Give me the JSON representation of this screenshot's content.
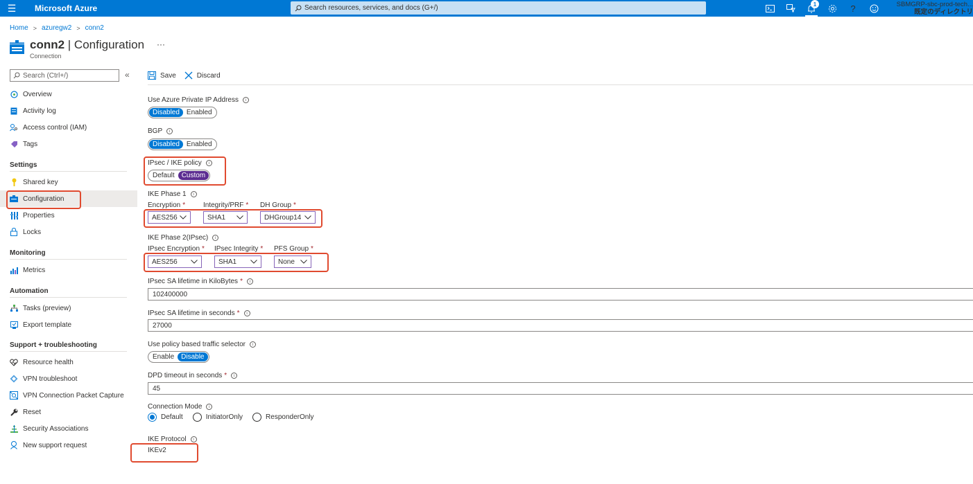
{
  "topbar": {
    "brand": "Microsoft Azure",
    "search_placeholder": "Search resources, services, and docs (G+/)",
    "notification_count": "1",
    "user_line1": "SBMGRP-sbc-prod-tech...",
    "user_line2": "既定のディレクトリ"
  },
  "breadcrumb": [
    "Home",
    "azuregw2",
    "conn2"
  ],
  "page": {
    "title_bold": "conn2",
    "title_rest": " | Configuration",
    "subtitle": "Connection",
    "more": "···"
  },
  "sidebar": {
    "search_placeholder": "Search (Ctrl+/)",
    "collapse": "«",
    "items": [
      {
        "label": "Overview",
        "icon": "overview-icon"
      },
      {
        "label": "Activity log",
        "icon": "activity-log-icon"
      },
      {
        "label": "Access control (IAM)",
        "icon": "iam-icon"
      },
      {
        "label": "Tags",
        "icon": "tag-icon"
      }
    ],
    "sections": [
      {
        "title": "Settings",
        "items": [
          {
            "label": "Shared key",
            "icon": "key-icon"
          },
          {
            "label": "Configuration",
            "icon": "configuration-icon",
            "active": true
          },
          {
            "label": "Properties",
            "icon": "properties-icon"
          },
          {
            "label": "Locks",
            "icon": "lock-icon"
          }
        ]
      },
      {
        "title": "Monitoring",
        "items": [
          {
            "label": "Metrics",
            "icon": "metrics-icon"
          }
        ]
      },
      {
        "title": "Automation",
        "items": [
          {
            "label": "Tasks (preview)",
            "icon": "tasks-icon"
          },
          {
            "label": "Export template",
            "icon": "export-template-icon"
          }
        ]
      },
      {
        "title": "Support + troubleshooting",
        "items": [
          {
            "label": "Resource health",
            "icon": "resource-health-icon"
          },
          {
            "label": "VPN troubleshoot",
            "icon": "vpn-troubleshoot-icon"
          },
          {
            "label": "VPN Connection Packet Capture",
            "icon": "packet-capture-icon"
          },
          {
            "label": "Reset",
            "icon": "reset-icon"
          },
          {
            "label": "Security Associations",
            "icon": "security-associations-icon"
          },
          {
            "label": "New support request",
            "icon": "support-icon"
          }
        ]
      }
    ]
  },
  "toolbar": {
    "save": "Save",
    "discard": "Discard"
  },
  "form": {
    "private_ip": {
      "label": "Use Azure Private IP Address",
      "options": [
        "Disabled",
        "Enabled"
      ],
      "selected": "Disabled"
    },
    "bgp": {
      "label": "BGP",
      "options": [
        "Disabled",
        "Enabled"
      ],
      "selected": "Disabled"
    },
    "ipsec_policy": {
      "label": "IPsec / IKE policy",
      "options": [
        "Default",
        "Custom"
      ],
      "selected": "Custom"
    },
    "ike_phase1": {
      "label": "IKE Phase 1",
      "encryption": {
        "label": "Encryption",
        "value": "AES256"
      },
      "integrity": {
        "label": "Integrity/PRF",
        "value": "SHA1"
      },
      "dh_group": {
        "label": "DH Group",
        "value": "DHGroup14"
      }
    },
    "ike_phase2": {
      "label": "IKE Phase 2(IPsec)",
      "encryption": {
        "label": "IPsec Encryption",
        "value": "AES256"
      },
      "integrity": {
        "label": "IPsec Integrity",
        "value": "SHA1"
      },
      "pfs_group": {
        "label": "PFS Group",
        "value": "None"
      }
    },
    "sa_kb": {
      "label": "IPsec SA lifetime in KiloBytes",
      "value": "102400000"
    },
    "sa_sec": {
      "label": "IPsec SA lifetime in seconds",
      "value": "27000"
    },
    "policy_selector": {
      "label": "Use policy based traffic selector",
      "options": [
        "Enable",
        "Disable"
      ],
      "selected": "Disable"
    },
    "dpd": {
      "label": "DPD timeout in seconds",
      "value": "45"
    },
    "conn_mode": {
      "label": "Connection Mode",
      "options": [
        "Default",
        "InitiatorOnly",
        "ResponderOnly"
      ],
      "selected": "Default"
    },
    "ike_protocol": {
      "label": "IKE Protocol",
      "value": "IKEv2"
    }
  },
  "colors": {
    "accent": "#0078d4",
    "custom_toggle": "#5c2d91",
    "highlight": "#e04a2f",
    "dropdown_border": "#8764b8"
  }
}
